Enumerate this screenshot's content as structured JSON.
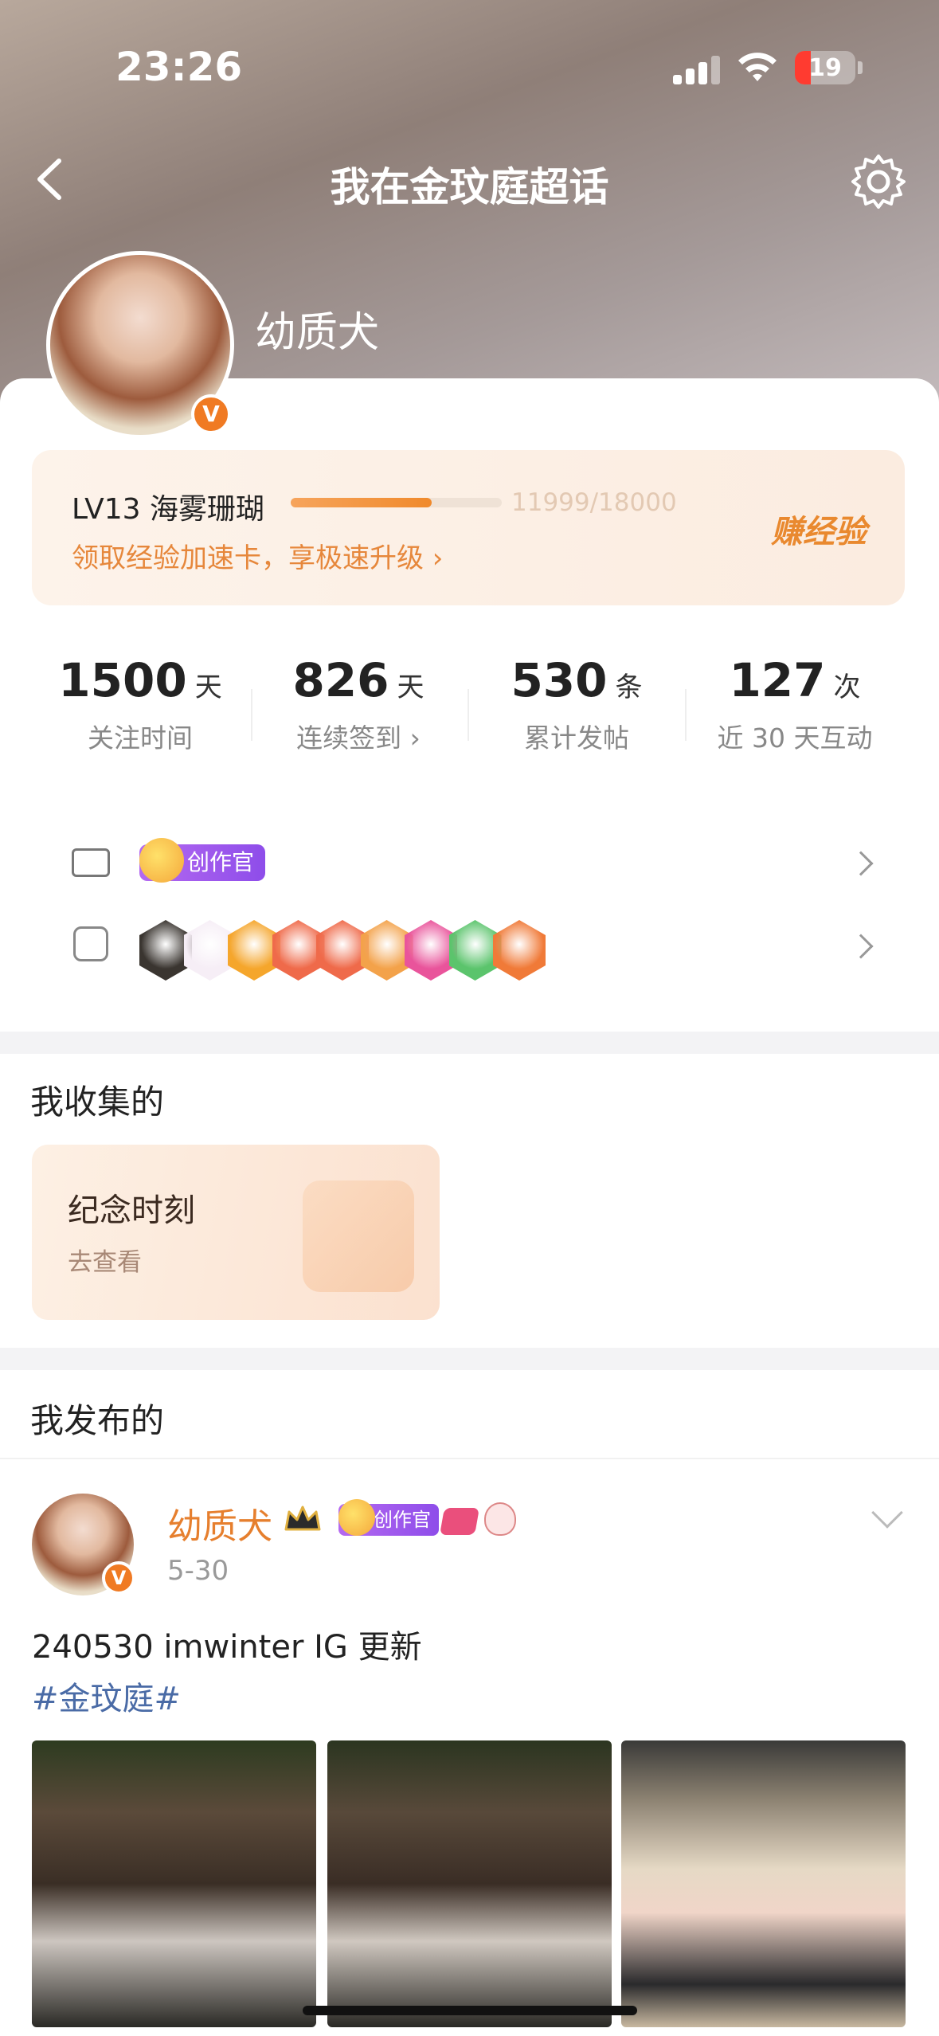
{
  "status_bar": {
    "time": "23:26",
    "battery": "19"
  },
  "nav": {
    "title": "我在金玟庭超话"
  },
  "profile": {
    "name": "幼质犬",
    "verified_badge": "V"
  },
  "level": {
    "title": "LV13 海雾珊瑚",
    "progress_text": "11999/18000",
    "progress_fraction": 0.667,
    "promo": "领取经验加速卡，享极速升级 ›",
    "earn_label": "赚经验"
  },
  "stats": [
    {
      "value": "1500",
      "unit": "天",
      "label": "关注时间"
    },
    {
      "value": "826",
      "unit": "天",
      "label": "连续签到 ›"
    },
    {
      "value": "530",
      "unit": "条",
      "label": "累计发帖"
    },
    {
      "value": "127",
      "unit": "次",
      "label": "近 30 天互动"
    }
  ],
  "badges": {
    "creator_label": "创作官",
    "medal_colors": [
      "#3a3530",
      "#f6eef6",
      "#f5a62c",
      "#ef6a4a",
      "#ef6a4a",
      "#f3a24a",
      "#e9549b",
      "#5bc46c",
      "#f07a38"
    ],
    "medal_names": [
      "super-medal-icon",
      "cake-medal-icon",
      "crown-medal-icon",
      "fox-medal-icon",
      "fox-medal-icon",
      "fox-king-medal-icon",
      "lv13-medal-icon",
      "hand-medal-icon",
      "100-days-medal-icon"
    ]
  },
  "collections": {
    "section_title": "我收集的",
    "moment_title": "纪念时刻",
    "moment_sub": "去查看"
  },
  "posts": {
    "section_title": "我发布的",
    "author": "幼质犬",
    "date": "5-30",
    "creator_label": "创作官",
    "text": "240530 imwinter IG 更新",
    "tag": "#金玟庭#"
  },
  "colors": {
    "accent_orange": "#f08a2c",
    "tag_blue": "#4a6ba6",
    "creator_purple": "#9a55ec"
  }
}
